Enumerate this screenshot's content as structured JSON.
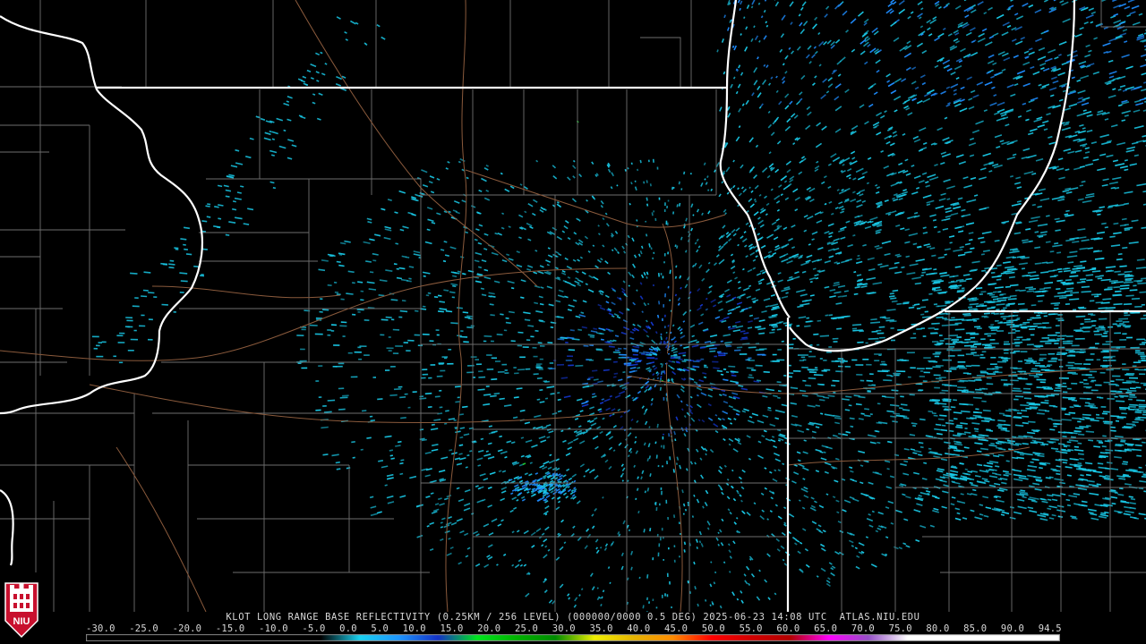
{
  "product": {
    "caption": "KLOT LONG RANGE BASE REFLECTIVITY (0.25KM / 256 LEVEL) (000000/0000 0.5 DEG) 2025-06-23 14:08 UTC  ATLAS.NIU.EDU",
    "logo_text": "NIU"
  },
  "colors": {
    "background": "#000000",
    "state_border": "#ffffff",
    "county_line": "#6e6e6e",
    "highway": "#8a5a3c",
    "echo_light": "#19c8e6",
    "echo_mid": "#1e8cff",
    "echo_dark": "#1438d2",
    "echo_green": "#1ec832",
    "logo_red": "#c8102e"
  },
  "icons": {
    "radar_site": "radar-site-dot",
    "logo": "niu-logo-icon"
  },
  "scale": {
    "labels": [
      "-30.0",
      "-25.0",
      "-20.0",
      "-15.0",
      "-10.0",
      "-5.0",
      "0.0",
      "5.0",
      "10.0",
      "15.0",
      "20.0",
      "25.0",
      "30.0",
      "35.0",
      "40.0",
      "45.0",
      "50.0",
      "55.0",
      "60.0",
      "65.0",
      "70.0",
      "75.0",
      "80.0",
      "85.0",
      "90.0",
      "94.5"
    ],
    "stops": [
      {
        "value": -30,
        "color": "#000000"
      },
      {
        "value": 0,
        "color": "#000000"
      },
      {
        "value": 5,
        "color": "#19d2f0"
      },
      {
        "value": 10,
        "color": "#1e96ff"
      },
      {
        "value": 15,
        "color": "#1432c8"
      },
      {
        "value": 20,
        "color": "#00e61e"
      },
      {
        "value": 25,
        "color": "#00b400"
      },
      {
        "value": 30,
        "color": "#008c00"
      },
      {
        "value": 35,
        "color": "#f0f000"
      },
      {
        "value": 40,
        "color": "#e6b400"
      },
      {
        "value": 45,
        "color": "#ff8c00"
      },
      {
        "value": 50,
        "color": "#ff0000"
      },
      {
        "value": 55,
        "color": "#d20000"
      },
      {
        "value": 60,
        "color": "#b40000"
      },
      {
        "value": 65,
        "color": "#ff00ff"
      },
      {
        "value": 70,
        "color": "#9650c8"
      },
      {
        "value": 75,
        "color": "#ffffff"
      },
      {
        "value": 94.5,
        "color": "#ffffff"
      }
    ]
  }
}
